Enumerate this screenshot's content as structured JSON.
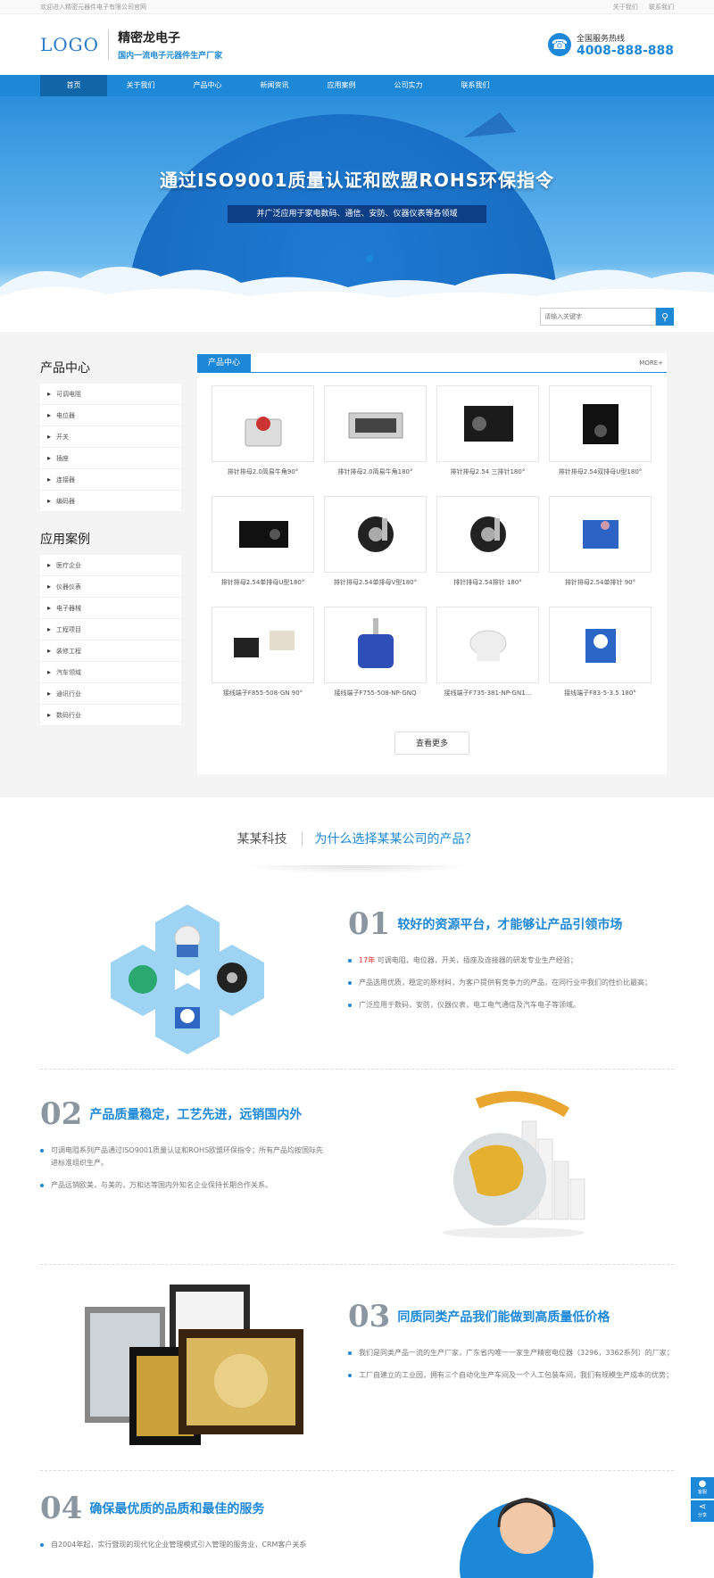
{
  "topbar": {
    "welcome": "欢迎进入精密元器件电子有限公司官网",
    "links": [
      "关于我们",
      "联系我们"
    ]
  },
  "header": {
    "logo": "LOGO",
    "brand_name": "精密龙电子",
    "slogan": "国内一流电子元器件生产厂家",
    "hotline_label": "全国服务热线",
    "hotline_number": "4008-888-888"
  },
  "nav": [
    "首页",
    "关于我们",
    "产品中心",
    "新闻资讯",
    "应用案例",
    "公司实力",
    "联系我们"
  ],
  "banner": {
    "title": "通过ISO9001质量认证和欧盟ROHS环保指令",
    "subtitle": "并广泛应用于家电数码、通信、安防、仪器仪表等各领域"
  },
  "search": {
    "placeholder": "请输入关键字"
  },
  "sidebar": {
    "products_title": "产品中心",
    "products": [
      "可调电阻",
      "电位器",
      "开关",
      "插座",
      "连接器",
      "编码器"
    ],
    "cases_title": "应用案例",
    "cases": [
      "医疗企业",
      "仪器仪表",
      "电子器械",
      "工程项目",
      "装修工程",
      "汽车领域",
      "通讯行业",
      "数码行业"
    ]
  },
  "products": {
    "tab": "产品中心",
    "more": "MORE+",
    "more_button": "查看更多",
    "items": [
      {
        "caption": "排针排母2.0简易牛角90°",
        "shape": "button"
      },
      {
        "caption": "排针排母2.0简易牛角180°",
        "shape": "usb"
      },
      {
        "caption": "排针排母2.54 三排针180°",
        "shape": "jack"
      },
      {
        "caption": "排针排母2.54双排母U型180°",
        "shape": "dc"
      },
      {
        "caption": "排针排母2.54单排母U型180°",
        "shape": "dc2"
      },
      {
        "caption": "排针排母2.54单排母V型180°",
        "shape": "pot"
      },
      {
        "caption": "排针排母2.54排针 180°",
        "shape": "pot"
      },
      {
        "caption": "排针排母2.54单排针 90°",
        "shape": "trim"
      },
      {
        "caption": "接线端子F855-508-GN 90°",
        "shape": "tact"
      },
      {
        "caption": "接线端子F755-508-NP-GNQ",
        "shape": "knob"
      },
      {
        "caption": "接线端子F735-381-NP-GN1...",
        "shape": "white"
      },
      {
        "caption": "接线端子F83-5-3.5 180°",
        "shape": "bluepot"
      }
    ]
  },
  "why": {
    "left": "某某科技",
    "right": "为什么选择某某公司的产品？"
  },
  "features": [
    {
      "num": "01",
      "title": "较好的资源平台，才能够让产品引领市场",
      "lines": [
        {
          "hl": "17年",
          "text": "可调电阻，电位器，开关，插座及连接器的研发专业生产经验；"
        },
        {
          "hl": "",
          "text": "产品选用优质，稳定的原材料，为客户提供有竞争力的产品，在同行业中我们的性价比最高；"
        },
        {
          "hl": "",
          "text": "广泛应用于数码，安防，仪器仪表，电工电气通信及汽车电子等领域。"
        }
      ]
    },
    {
      "num": "02",
      "title": "产品质量稳定，工艺先进，远销国内外",
      "lines": [
        {
          "hl": "",
          "text": "可调电阻系列产品通过ISO9001质量认证和ROHS欧盟环保指令；所有产品均按国际先进标准组织生产。"
        },
        {
          "hl": "",
          "text": "产品远销欧美，与美的，万和达等国内外知名企业保持长期合作关系。"
        }
      ]
    },
    {
      "num": "03",
      "title": "同质同类产品我们能做到高质量低价格",
      "lines": [
        {
          "hl": "",
          "text": "我们是同类产品一流的生产厂家，广东省内唯一一家生产精密电位器（3296，3362系列）的厂家；"
        },
        {
          "hl": "",
          "text": "工厂自建立的工业园，拥有三个自动化生产车间及一个人工包装车间，我们有规模生产成本的优势；"
        }
      ]
    },
    {
      "num": "04",
      "title": "确保最优质的品质和最佳的服务",
      "lines": [
        {
          "hl": "",
          "text": "自2004年起，实行暨现的现代化企业管理模式引入管理的服务业，CRM客户关系"
        }
      ]
    }
  ],
  "widget": {
    "qq": "客服",
    "share": "分享"
  },
  "colors": {
    "accent": "#1e88d8",
    "nav_active": "#1166aa",
    "highlight": "#e33333"
  }
}
